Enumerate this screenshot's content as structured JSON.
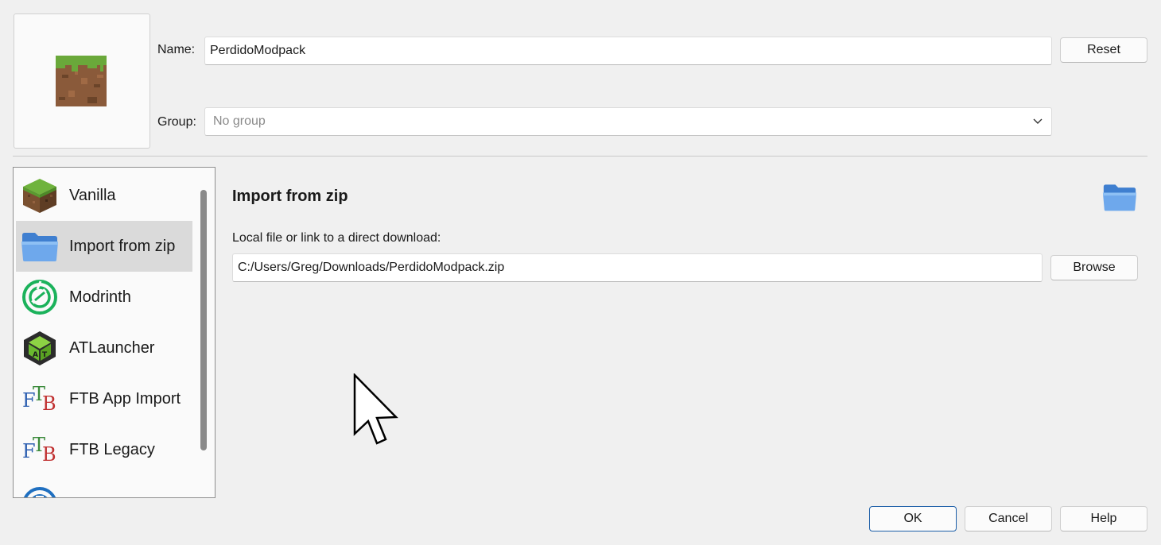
{
  "instance": {
    "name_label": "Name:",
    "name_value": "PerdidoModpack",
    "reset_label": "Reset",
    "group_label": "Group:",
    "group_placeholder": "No group",
    "icon": "grass-block-icon"
  },
  "sidebar": {
    "items": [
      {
        "label": "Vanilla",
        "icon": "grass-block-icon"
      },
      {
        "label": "Import from zip",
        "icon": "folder-icon",
        "selected": true
      },
      {
        "label": "Modrinth",
        "icon": "modrinth-icon"
      },
      {
        "label": "ATLauncher",
        "icon": "atlauncher-icon"
      },
      {
        "label": "FTB App Import",
        "icon": "ftb-icon"
      },
      {
        "label": "FTB Legacy",
        "icon": "ftb-icon"
      },
      {
        "label": "",
        "icon": "curseforge-icon"
      }
    ]
  },
  "main": {
    "title": "Import from zip",
    "icon": "folder-icon",
    "path_label": "Local file or link to a direct download:",
    "path_value": "C:/Users/Greg/Downloads/PerdidoModpack.zip",
    "browse_label": "Browse"
  },
  "footer": {
    "ok_label": "OK",
    "cancel_label": "Cancel",
    "help_label": "Help"
  },
  "colors": {
    "accent": "#1d5fa8",
    "background": "#f0f0f0",
    "selected": "#dadada"
  }
}
